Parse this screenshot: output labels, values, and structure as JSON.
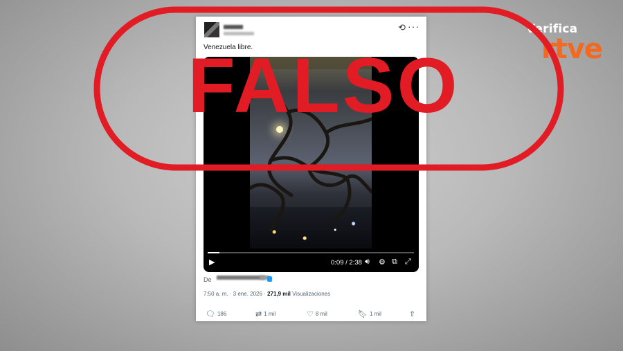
{
  "brand": {
    "top": "Verifica",
    "logo": "rtve"
  },
  "stamp": {
    "text": "FALSO",
    "color": "#e21c24"
  },
  "post": {
    "text": "Venezuela libre.",
    "video": {
      "time": "0:09 / 2:38",
      "progress": 0.057
    },
    "from_label": "De",
    "timestamp": "7:50 a. m. · 3 ene. 2026 · ",
    "views_count": "271,9 mil",
    "views_label": " Visualizaciones",
    "actions": {
      "replies": "186",
      "reposts": "1 mil",
      "likes": "8 mil",
      "bookmarks": "1 mil"
    }
  },
  "icons": [
    "grok-icon",
    "more-icon",
    "play-icon",
    "volume-icon",
    "gear-icon",
    "pip-icon",
    "expand-icon",
    "reply-icon",
    "repost-icon",
    "like-icon",
    "bookmark-icon",
    "share-icon"
  ]
}
